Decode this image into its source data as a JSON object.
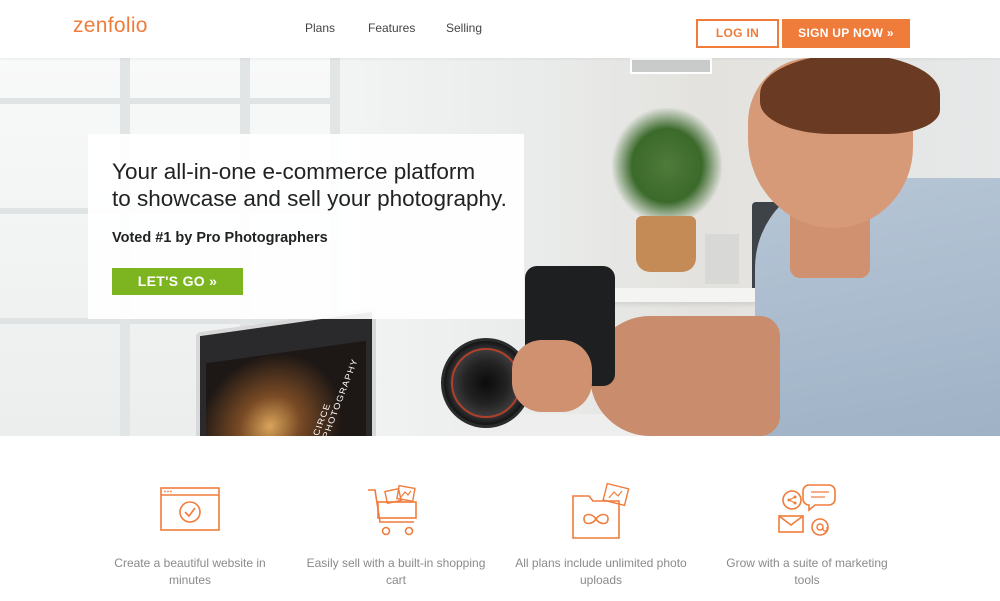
{
  "brand": {
    "logo": "zenfolio",
    "accent": "#f07c3b",
    "green": "#7cb51f"
  },
  "nav": {
    "items": [
      "Plans",
      "Features",
      "Selling"
    ]
  },
  "header": {
    "login_label": "LOG IN",
    "signup_label": "SIGN UP NOW »"
  },
  "hero": {
    "title_line1": "Your all-in-one e-commerce platform",
    "title_line2": "to showcase and sell your photography.",
    "subtitle": "Voted #1 by Pro Photographers",
    "cta_label": "LET'S GO »",
    "laptop_screen_text": "CIRCE PHOTOGRAPHY"
  },
  "features": [
    {
      "icon": "website-check-icon",
      "line1": "Create a beautiful website in",
      "line2": "minutes"
    },
    {
      "icon": "shopping-cart-icon",
      "line1": "Easily sell with a built-in shopping",
      "line2": "cart"
    },
    {
      "icon": "unlimited-folder-icon",
      "line1": "All plans include unlimited photo",
      "line2": "uploads"
    },
    {
      "icon": "marketing-icon",
      "line1": "Grow with a suite of marketing",
      "line2": "tools"
    }
  ]
}
